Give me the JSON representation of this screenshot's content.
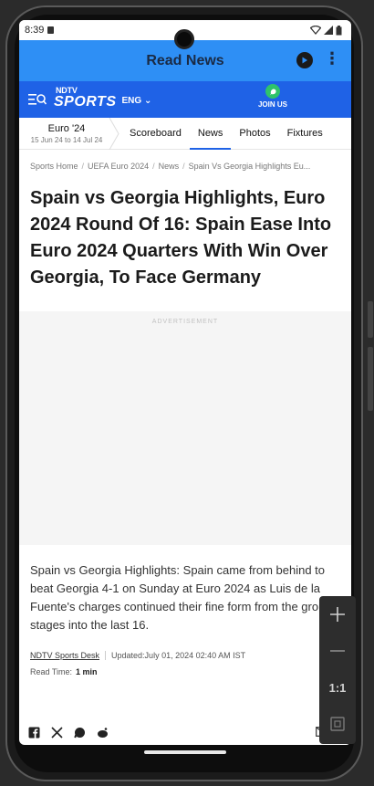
{
  "status": {
    "time": "8:39"
  },
  "appbar": {
    "title": "Read News",
    "more": "⋮"
  },
  "site": {
    "brand_small": "NDTV",
    "brand_big": "SPORTS",
    "language": "ENG",
    "join": "JOIN US"
  },
  "tabs": {
    "event_title": "Euro '24",
    "event_dates": "15 Jun 24 to 14 Jul 24",
    "items": [
      {
        "label": "Scoreboard"
      },
      {
        "label": "News"
      },
      {
        "label": "Photos"
      },
      {
        "label": "Fixtures"
      }
    ],
    "active": "News"
  },
  "breadcrumb": [
    "Sports Home",
    "UEFA Euro 2024",
    "News",
    "Spain Vs Georgia Highlights Eu..."
  ],
  "article": {
    "headline": "Spain vs Georgia Highlights, Euro 2024 Round Of 16: Spain Ease Into Euro 2024 Quarters With Win Over Georgia, To Face Germany",
    "ad_label": "ADVERTISEMENT",
    "body": "Spain vs Georgia Highlights: Spain came from behind to beat Georgia 4-1 on Sunday at Euro 2024 as Luis de la Fuente's charges continued their fine form from the group stages into the last 16.",
    "author": "NDTV Sports Desk",
    "updated": "Updated:July 01, 2024 02:40 AM IST",
    "read_time_label": "Read Time:",
    "read_time_value": "1 min"
  },
  "share": [
    "facebook-icon",
    "x-icon",
    "whatsapp-icon",
    "reddit-icon",
    "mail-icon"
  ],
  "float_panel": {
    "zoom_label": "1:1"
  }
}
